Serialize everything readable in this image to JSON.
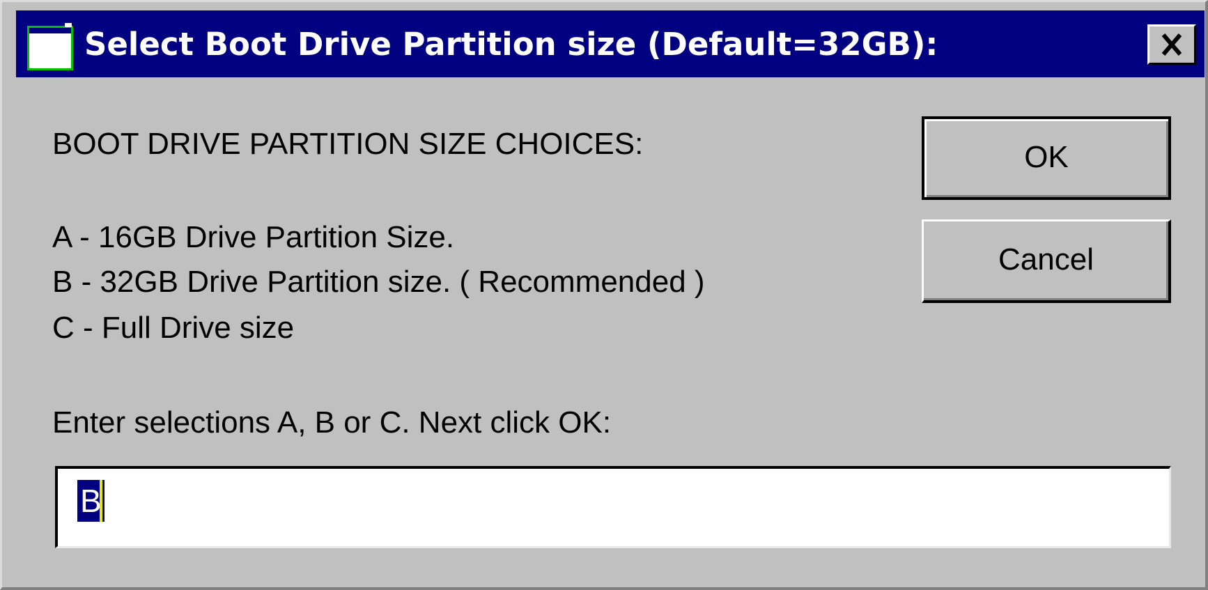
{
  "window": {
    "title": "Select Boot Drive Partition size (Default=32GB):",
    "close_label": "✕"
  },
  "dialog": {
    "heading": "BOOT DRIVE PARTITION SIZE CHOICES:",
    "options": [
      "A - 16GB Drive Partition Size.",
      "B - 32GB Drive Partition size. ( Recommended )",
      "C - Full Drive size"
    ],
    "prompt": "Enter selections A, B or C. Next click OK:"
  },
  "buttons": {
    "ok_label": "OK",
    "cancel_label": "Cancel"
  },
  "input": {
    "value": "B"
  },
  "colors": {
    "titlebar": "#000080",
    "dialog_face": "#c0c0c0",
    "selection_highlight": "#000080"
  },
  "icons": {
    "title_icon": "window-app-icon",
    "close_icon": "close-x-icon"
  }
}
